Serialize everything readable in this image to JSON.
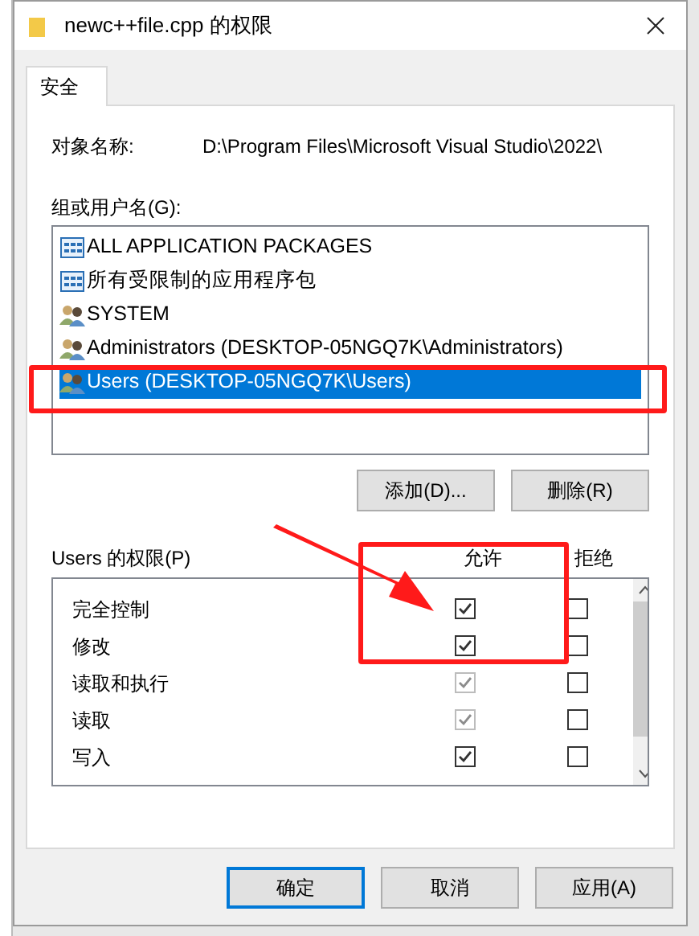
{
  "window": {
    "title": "newc++file.cpp 的权限"
  },
  "tabs": [
    {
      "label": "安全",
      "selected": true
    }
  ],
  "object_name": {
    "label": "对象名称:",
    "value": "D:\\Program Files\\Microsoft Visual Studio\\2022\\"
  },
  "groups": {
    "label": "组或用户名(G):",
    "items": [
      {
        "kind": "package",
        "name": "ALL APPLICATION PACKAGES",
        "selected": false
      },
      {
        "kind": "package",
        "name": "所有受限制的应用程序包",
        "selected": false
      },
      {
        "kind": "users",
        "name": "SYSTEM",
        "selected": false
      },
      {
        "kind": "users",
        "name": "Administrators (DESKTOP-05NGQ7K\\Administrators)",
        "selected": false
      },
      {
        "kind": "users",
        "name": "Users (DESKTOP-05NGQ7K\\Users)",
        "selected": true
      }
    ],
    "buttons": [
      "添加(D)...",
      "删除(R)"
    ]
  },
  "permissions": {
    "label": "Users 的权限(P)",
    "columns": [
      "允许",
      "拒绝"
    ],
    "rows": [
      {
        "name": "完全控制",
        "allow": true,
        "allow_disabled": false,
        "deny": false
      },
      {
        "name": "修改",
        "allow": true,
        "allow_disabled": false,
        "deny": false
      },
      {
        "name": "读取和执行",
        "allow": true,
        "allow_disabled": true,
        "deny": false
      },
      {
        "name": "读取",
        "allow": true,
        "allow_disabled": true,
        "deny": false
      },
      {
        "name": "写入",
        "allow": true,
        "allow_disabled": false,
        "deny": false
      }
    ]
  },
  "buttons": [
    {
      "label": "确定",
      "default": true
    },
    {
      "label": "取消",
      "default": false
    },
    {
      "label": "应用(A)",
      "default": false
    }
  ]
}
